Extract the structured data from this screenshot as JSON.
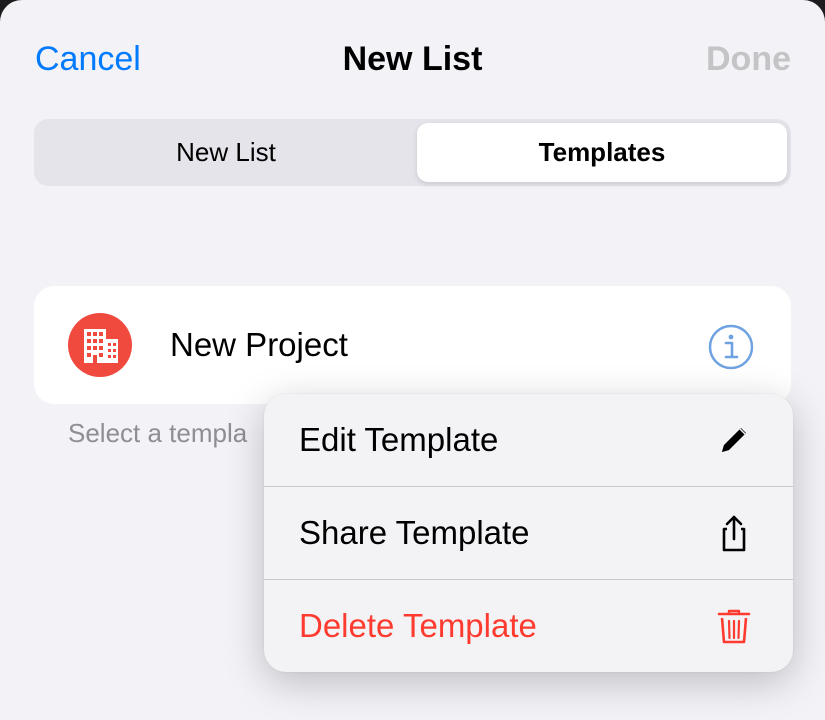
{
  "nav": {
    "cancel_label": "Cancel",
    "title": "New List",
    "done_label": "Done"
  },
  "segments": {
    "items": [
      {
        "label": "New List",
        "selected": false
      },
      {
        "label": "Templates",
        "selected": true
      }
    ]
  },
  "templates": {
    "items": [
      {
        "name": "New Project",
        "icon": "building-icon",
        "icon_color": "#f04a3e"
      }
    ],
    "footer_note": "Select a templa"
  },
  "context_menu": {
    "items": [
      {
        "label": "Edit Template",
        "icon": "pencil-icon",
        "destructive": false
      },
      {
        "label": "Share Template",
        "icon": "share-icon",
        "destructive": false
      },
      {
        "label": "Delete Template",
        "icon": "trash-icon",
        "destructive": true
      }
    ]
  },
  "colors": {
    "accent": "#007aff",
    "destructive": "#ff3b30",
    "disabled": "#c4c4c6",
    "secondary_text": "#8e8e93"
  }
}
